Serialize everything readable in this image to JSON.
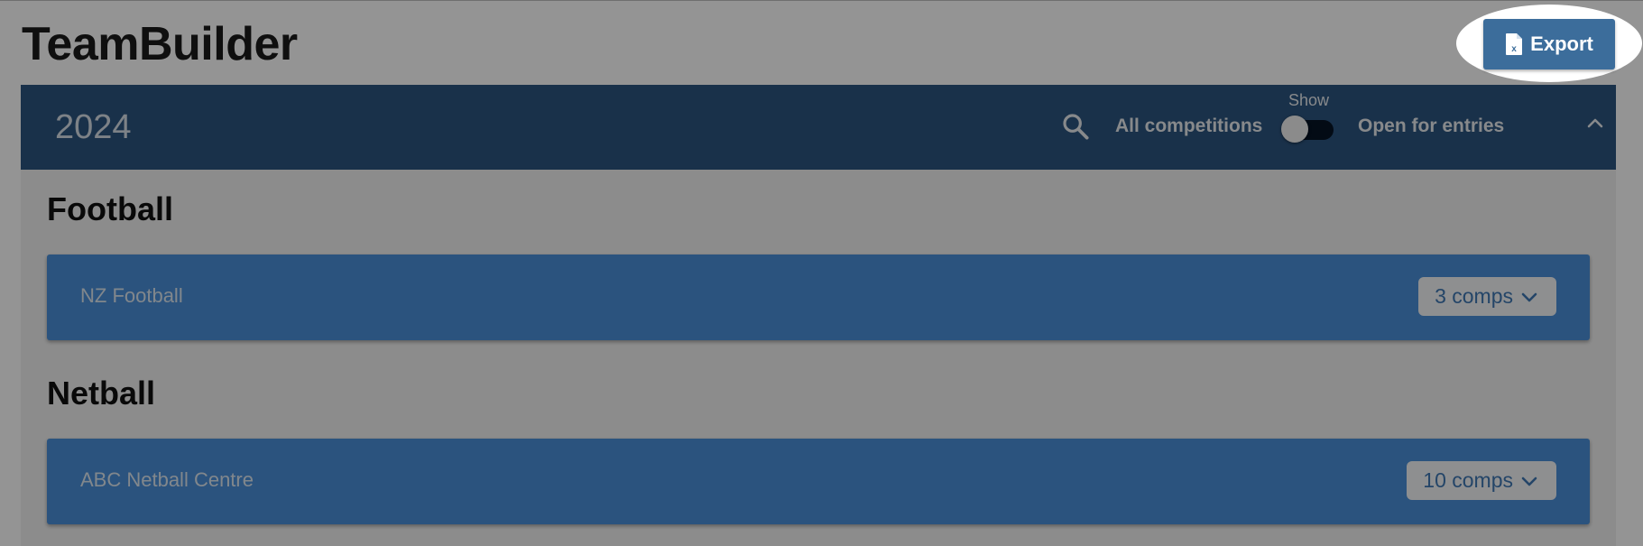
{
  "app": {
    "title": "TeamBuilder"
  },
  "toolbar": {
    "export_label": "Export",
    "export_icon": "excel-file-icon"
  },
  "season": {
    "year": "2024",
    "search_icon": "search-icon",
    "filter_all_label": "All competitions",
    "toggle_label": "Show",
    "toggle_on": false,
    "filter_open_label": "Open for entries",
    "collapse_icon": "chevron-up-icon"
  },
  "sports": [
    {
      "name": "Football",
      "organisations": [
        {
          "name": "NZ Football",
          "comps_label": "3 comps"
        }
      ]
    },
    {
      "name": "Netball",
      "organisations": [
        {
          "name": "ABC Netball Centre",
          "comps_label": "10 comps"
        }
      ]
    }
  ],
  "colors": {
    "header": "#2c5580",
    "accent": "#3c6d9b",
    "org_row": "#4a8fd9",
    "chip_text": "#3f78b3"
  }
}
